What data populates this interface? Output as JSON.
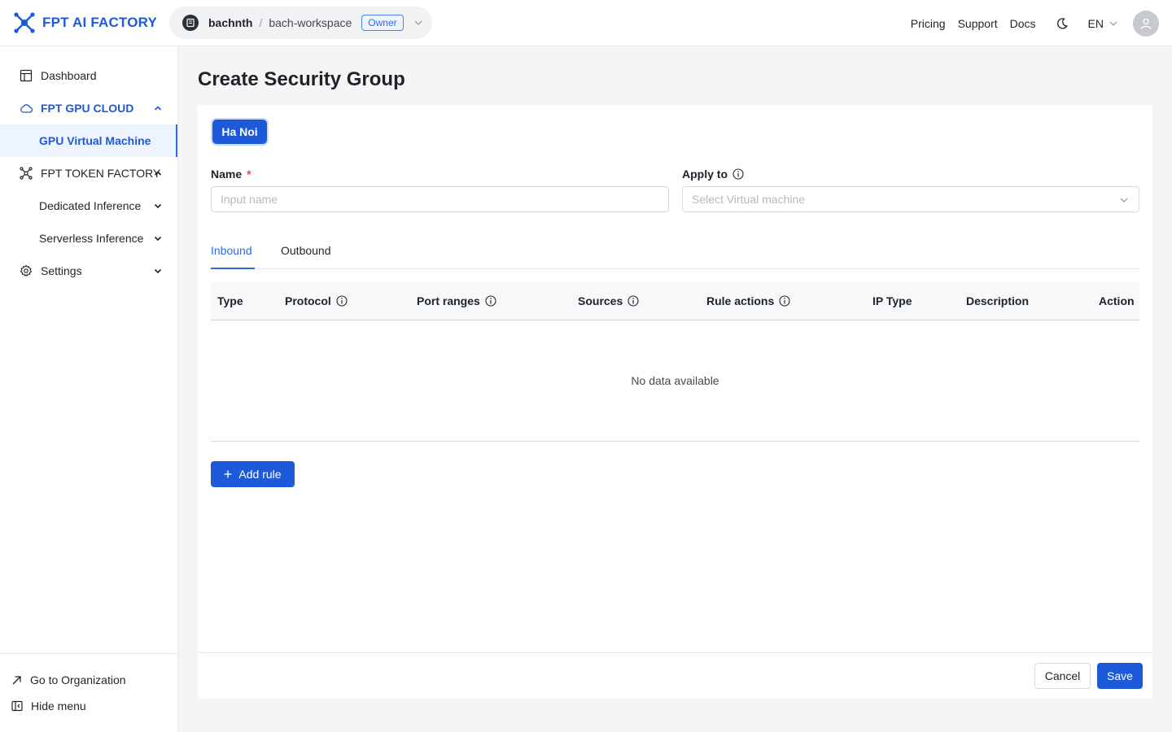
{
  "header": {
    "brand": "FPT AI FACTORY",
    "workspace": {
      "user": "bachnth",
      "separator": "/",
      "name": "bach-workspace",
      "role": "Owner"
    },
    "links": [
      "Pricing",
      "Support",
      "Docs"
    ],
    "language": "EN"
  },
  "sidebar": {
    "items": [
      {
        "label": "Dashboard"
      },
      {
        "label": "FPT GPU CLOUD"
      },
      {
        "label": "GPU Virtual Machine"
      },
      {
        "label": "FPT TOKEN FACTORY"
      },
      {
        "label": "Dedicated Inference"
      },
      {
        "label": "Serverless Inference"
      },
      {
        "label": "Settings"
      }
    ],
    "bottom": {
      "go_to_org": "Go to Organization",
      "hide_menu": "Hide menu"
    }
  },
  "page": {
    "title": "Create Security Group",
    "region": "Ha Noi",
    "name_label": "Name",
    "required_mark": "*",
    "name_placeholder": "Input name",
    "apply_label": "Apply to",
    "apply_placeholder": "Select Virtual machine",
    "tabs": [
      "Inbound",
      "Outbound"
    ],
    "columns": [
      "Type",
      "Protocol",
      "Port ranges",
      "Sources",
      "Rule actions",
      "IP Type",
      "Description",
      "Action"
    ],
    "empty_text": "No data available",
    "add_rule": "Add rule",
    "cancel": "Cancel",
    "save": "Save"
  },
  "colors": {
    "primary": "#1d5ad9",
    "accent_light": "#edf3ff"
  }
}
